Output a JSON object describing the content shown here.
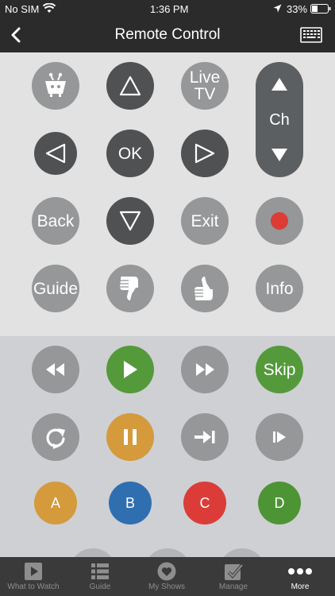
{
  "status_bar": {
    "carrier": "No SIM",
    "time": "1:36 PM",
    "battery": "33%"
  },
  "header": {
    "title": "Remote Control"
  },
  "buttons": {
    "live_tv": "Live\nTV",
    "ok": "OK",
    "back": "Back",
    "exit": "Exit",
    "guide": "Guide",
    "info": "Info",
    "channel": "Ch",
    "skip": "Skip",
    "a": "A",
    "b": "B",
    "c": "C",
    "d": "D"
  },
  "colors": {
    "top_panel": "#e2e2e2",
    "bottom_panel": "#ced0d4",
    "gray_button": "#959798",
    "dark_button": "#4f5153",
    "play_green": "#549a3b",
    "pause_orange": "#d49a3c",
    "a_button": "#d49a3c",
    "b_button": "#2f6fb0",
    "c_button": "#db3c38",
    "d_button": "#4d9534",
    "record": "#dd3b35"
  },
  "tabbar": {
    "items": [
      {
        "label": "What to Watch",
        "icon": "play-square-icon"
      },
      {
        "label": "Guide",
        "icon": "list-icon"
      },
      {
        "label": "My Shows",
        "icon": "heart-icon"
      },
      {
        "label": "Manage",
        "icon": "check-box-icon"
      },
      {
        "label": "More",
        "icon": "more-dots-icon",
        "active": true
      }
    ]
  }
}
